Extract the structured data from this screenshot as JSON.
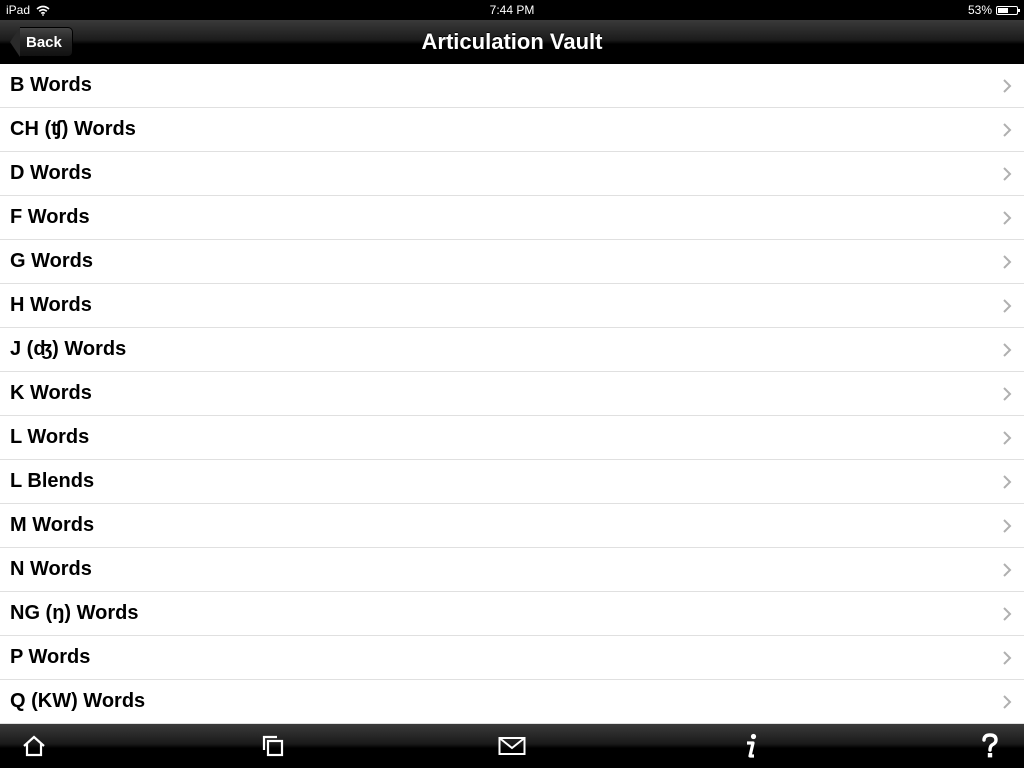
{
  "status_bar": {
    "device": "iPad",
    "time": "7:44 PM",
    "battery": "53%",
    "battery_level": 0.53
  },
  "nav": {
    "title": "Articulation Vault",
    "back_label": "Back"
  },
  "list": {
    "items": [
      {
        "label": "B Words"
      },
      {
        "label": "CH (ʧ) Words"
      },
      {
        "label": "D Words"
      },
      {
        "label": "F Words"
      },
      {
        "label": "G Words"
      },
      {
        "label": "H Words"
      },
      {
        "label": "J (ʤ) Words"
      },
      {
        "label": "K Words"
      },
      {
        "label": "L Words"
      },
      {
        "label": "L Blends"
      },
      {
        "label": "M Words"
      },
      {
        "label": "N Words"
      },
      {
        "label": "NG (ŋ) Words"
      },
      {
        "label": "P Words"
      },
      {
        "label": "Q (KW) Words"
      }
    ]
  },
  "toolbar": {
    "icons": [
      "home-icon",
      "copy-icon",
      "mail-icon",
      "info-icon",
      "help-icon"
    ]
  },
  "colors": {
    "bar": "#000000",
    "row_border": "#e0e0e0",
    "chevron": "#b0b0b0"
  }
}
